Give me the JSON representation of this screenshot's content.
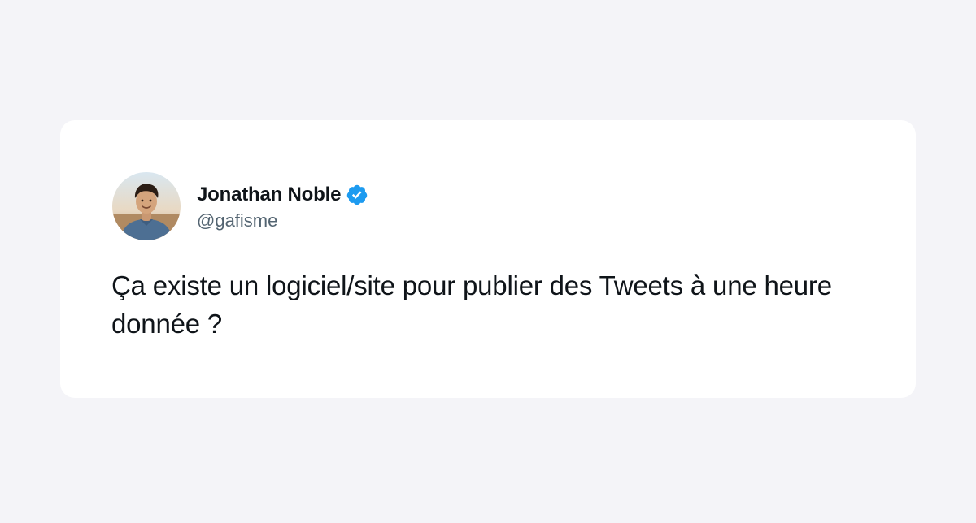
{
  "tweet": {
    "author": {
      "display_name": "Jonathan Noble",
      "handle": "@gafisme",
      "verified": true,
      "avatar_icon": "profile-photo"
    },
    "text": "Ça existe un logiciel/site pour publier des Tweets à une heure donnée ?"
  },
  "colors": {
    "page_background": "#f4f4f8",
    "card_background": "#ffffff",
    "verified_badge": "#1d9bf0",
    "text_primary": "#0f1419",
    "text_secondary": "#536471"
  }
}
